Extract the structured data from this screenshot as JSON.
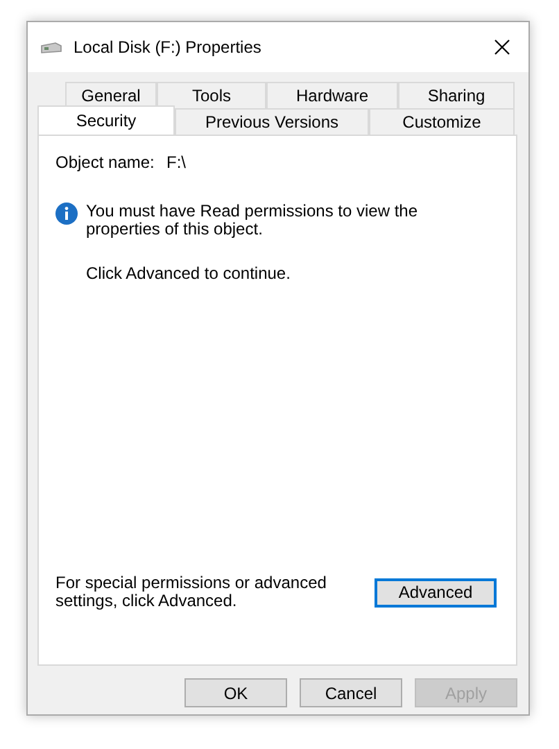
{
  "window": {
    "title": "Local Disk (F:) Properties"
  },
  "tab_rows": [
    [
      {
        "label": "General",
        "selected": false
      },
      {
        "label": "Tools",
        "selected": false
      },
      {
        "label": "Hardware",
        "selected": false
      },
      {
        "label": "Sharing",
        "selected": false
      }
    ],
    [
      {
        "label": "Security",
        "selected": true
      },
      {
        "label": "Previous Versions",
        "selected": false
      },
      {
        "label": "Customize",
        "selected": false
      }
    ]
  ],
  "object_name": {
    "label": "Object name:",
    "value": "F:\\"
  },
  "info_message": "You must have Read permissions to view the properties of this object.",
  "continue_text": "Click Advanced to continue.",
  "advanced_note": "For special permissions or advanced settings, click Advanced.",
  "advanced_button": {
    "label": "Advanced",
    "focused": true
  },
  "buttons": [
    {
      "label": "OK",
      "disabled": false
    },
    {
      "label": "Cancel",
      "disabled": false
    },
    {
      "label": "Apply",
      "disabled": true
    }
  ]
}
